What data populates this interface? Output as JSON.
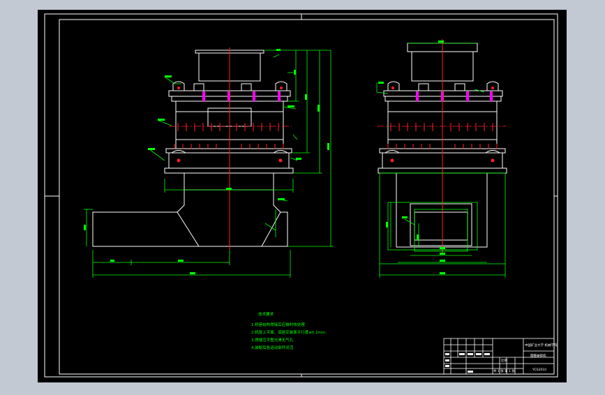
{
  "colors": {
    "app_background": "#c2c9d3",
    "canvas": "#000000",
    "line": "#ffffff",
    "center_line": "#ff2020",
    "dimension": "#00ff00",
    "part": "#ff00ff"
  },
  "notes": {
    "heading": "技术要求",
    "items": [
      "1.机座结构焊接后应做时效处理.",
      "2.机座上平面、底座安装面平行度≤0.1mm.",
      "3.焊缝应平整光滑无气孔.",
      "4.装配后各运动部件灵活."
    ]
  },
  "title_block": {
    "school": "中国矿业大学 机械学院",
    "drawing_name": "圆锥破碎机",
    "drawing_no": "YCS2010",
    "scale_label": "比例",
    "sheet_label": "共 1 张 第 1 张"
  }
}
